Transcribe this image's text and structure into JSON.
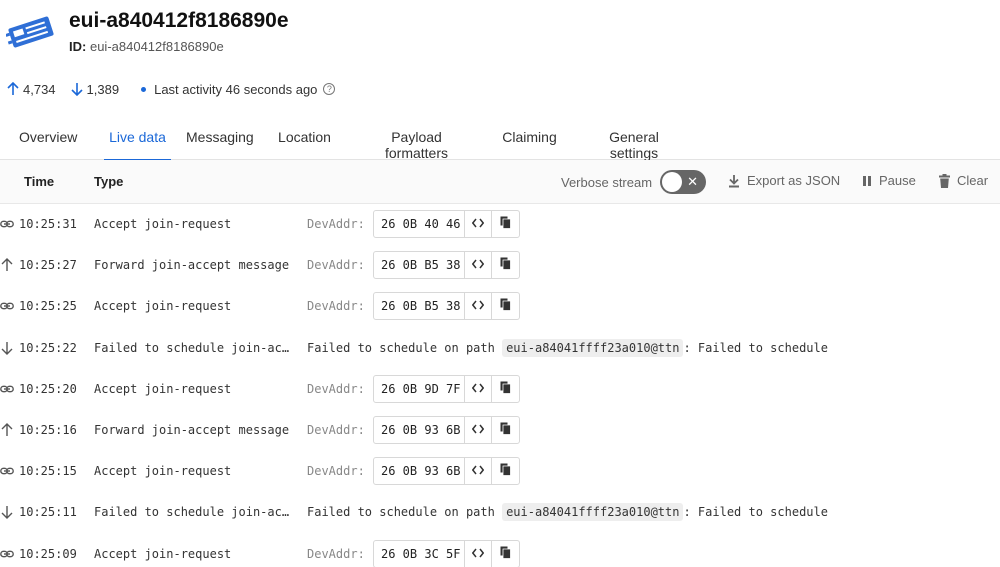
{
  "device": {
    "title": "eui-a840412f8186890e",
    "id_label": "ID:",
    "id_value": "eui-a840412f8186890e"
  },
  "stats": {
    "uplink_count": "4,734",
    "downlink_count": "1,389",
    "last_activity": "Last activity 46 seconds ago"
  },
  "tabs": [
    {
      "label": "Overview"
    },
    {
      "label": "Live data",
      "active": true
    },
    {
      "label": "Messaging"
    },
    {
      "label": "Location"
    },
    {
      "label": "Payload formatters"
    },
    {
      "label": "Claiming"
    },
    {
      "label": "General settings"
    }
  ],
  "toolbar": {
    "time_header": "Time",
    "type_header": "Type",
    "verbose_label": "Verbose stream",
    "verbose_on": false,
    "export_label": "Export as JSON",
    "pause_label": "Pause",
    "clear_label": "Clear"
  },
  "events": [
    {
      "icon": "link-icon",
      "time": "10:25:31",
      "type": "Accept join-request",
      "field": "DevAddr:",
      "value": "26 0B 40 46"
    },
    {
      "icon": "arrow-up-icon",
      "time": "10:25:27",
      "type": "Forward join-accept message",
      "field": "DevAddr:",
      "value": "26 0B B5 38"
    },
    {
      "icon": "link-icon",
      "time": "10:25:25",
      "type": "Accept join-request",
      "field": "DevAddr:",
      "value": "26 0B B5 38"
    },
    {
      "icon": "arrow-down-icon",
      "time": "10:25:22",
      "type": "Failed to schedule join-ac…",
      "fail_prefix": "Failed to schedule on path",
      "fail_path": "eui-a84041ffff23a010@ttn",
      "fail_suffix": ": Failed to schedule"
    },
    {
      "icon": "link-icon",
      "time": "10:25:20",
      "type": "Accept join-request",
      "field": "DevAddr:",
      "value": "26 0B 9D 7F"
    },
    {
      "icon": "arrow-up-icon",
      "time": "10:25:16",
      "type": "Forward join-accept message",
      "field": "DevAddr:",
      "value": "26 0B 93 6B"
    },
    {
      "icon": "link-icon",
      "time": "10:25:15",
      "type": "Accept join-request",
      "field": "DevAddr:",
      "value": "26 0B 93 6B"
    },
    {
      "icon": "arrow-down-icon",
      "time": "10:25:11",
      "type": "Failed to schedule join-ac…",
      "fail_prefix": "Failed to schedule on path",
      "fail_path": "eui-a84041ffff23a010@ttn",
      "fail_suffix": ": Failed to schedule"
    },
    {
      "icon": "link-icon",
      "time": "10:25:09",
      "type": "Accept join-request",
      "field": "DevAddr:",
      "value": "26 0B 3C 5F"
    }
  ],
  "colors": {
    "accent": "#1b68d8",
    "device_icon": "#2f6fd6"
  }
}
